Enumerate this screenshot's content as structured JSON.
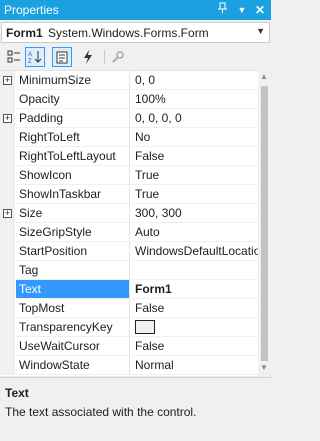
{
  "window": {
    "title": "Properties",
    "icons": [
      "pin-icon",
      "dropdown-arrow-icon",
      "close-icon"
    ]
  },
  "object_selector": {
    "name": "Form1",
    "type": "System.Windows.Forms.Form"
  },
  "toolbar": {
    "buttons": [
      "categorized-icon",
      "alphabetical-icon",
      "properties-icon",
      "events-icon",
      "property-pages-icon"
    ],
    "active": [
      "alphabetical-icon",
      "properties-icon"
    ]
  },
  "properties": [
    {
      "name": "MinimumSize",
      "value": "0, 0",
      "expandable": true
    },
    {
      "name": "Opacity",
      "value": "100%"
    },
    {
      "name": "Padding",
      "value": "0, 0, 0, 0",
      "expandable": true
    },
    {
      "name": "RightToLeft",
      "value": "No"
    },
    {
      "name": "RightToLeftLayout",
      "value": "False"
    },
    {
      "name": "ShowIcon",
      "value": "True"
    },
    {
      "name": "ShowInTaskbar",
      "value": "True"
    },
    {
      "name": "Size",
      "value": "300, 300",
      "expandable": true
    },
    {
      "name": "SizeGripStyle",
      "value": "Auto"
    },
    {
      "name": "StartPosition",
      "value": "WindowsDefaultLocation"
    },
    {
      "name": "Tag",
      "value": ""
    },
    {
      "name": "Text",
      "value": "Form1",
      "selected": true
    },
    {
      "name": "TopMost",
      "value": "False"
    },
    {
      "name": "TransparencyKey",
      "value": ""
    },
    {
      "name": "UseWaitCursor",
      "value": "False"
    },
    {
      "name": "WindowState",
      "value": "Normal"
    }
  ],
  "description": {
    "title": "Text",
    "text": "The text associated with the control."
  },
  "colors": {
    "titlebar": "#1ba1e2",
    "selection": "#3399ff"
  }
}
